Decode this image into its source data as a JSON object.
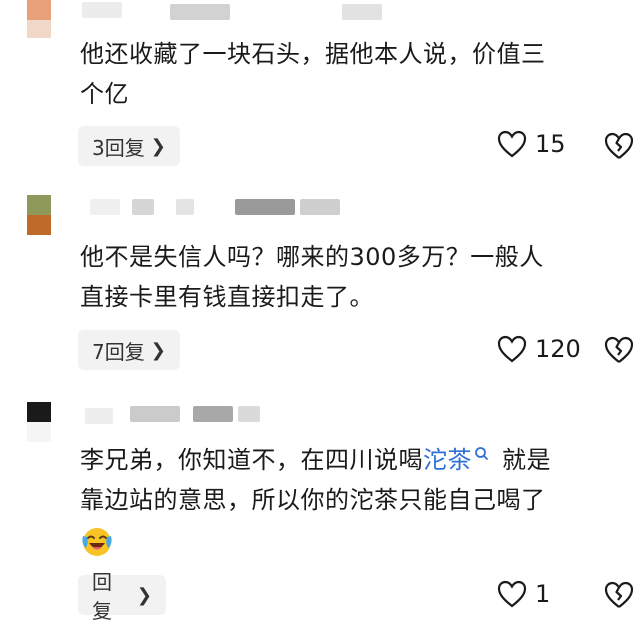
{
  "comments": [
    {
      "text_line1": "他还收藏了一块石头，据他本人说，价值三",
      "text_line2": "个亿",
      "reply_label": "3回复",
      "likes": "15",
      "avatar_colors": [
        "#e8a07a",
        "#f0d8c8"
      ],
      "name_blur_colors": [
        "#cfcfcf",
        "#e6e6e6",
        "#bdbdbd",
        "#dcdcdc"
      ]
    },
    {
      "text_line1": "他不是失信人吗？哪来的300多万？一般人",
      "text_line2": "直接卡里有钱直接扣走了。",
      "reply_label": "7回复",
      "likes": "120",
      "avatar_colors": [
        "#8f9a5a",
        "#c06a2a"
      ],
      "name_blur_colors": [
        "#eeeeee",
        "#d6d6d6",
        "#9a9a9a",
        "#cfcfcf"
      ]
    },
    {
      "text_part1": "李兄弟，你知道不，在四川说喝",
      "link_word": "沱茶",
      "text_part2": "就是",
      "text_line2": "靠边站的意思，所以你的沱茶只能自己喝了",
      "reply_label": "回复",
      "likes": "1",
      "avatar_colors": [
        "#1a1a1a",
        "#f5f5f5"
      ],
      "name_blur_colors": [
        "#e3e3e3",
        "#c9c9c9",
        "#a8a8a8",
        "#dadada"
      ]
    }
  ],
  "icons": {
    "heart": "heart-outline-icon",
    "dislike": "broken-heart-icon",
    "search": "search-icon",
    "chevron": "chevron-right-icon",
    "emoji": "laughing-crying-emoji-icon"
  },
  "colors": {
    "link": "#2f6fd6",
    "pill_bg": "#f2f2f2",
    "text": "#1a1a1a"
  }
}
